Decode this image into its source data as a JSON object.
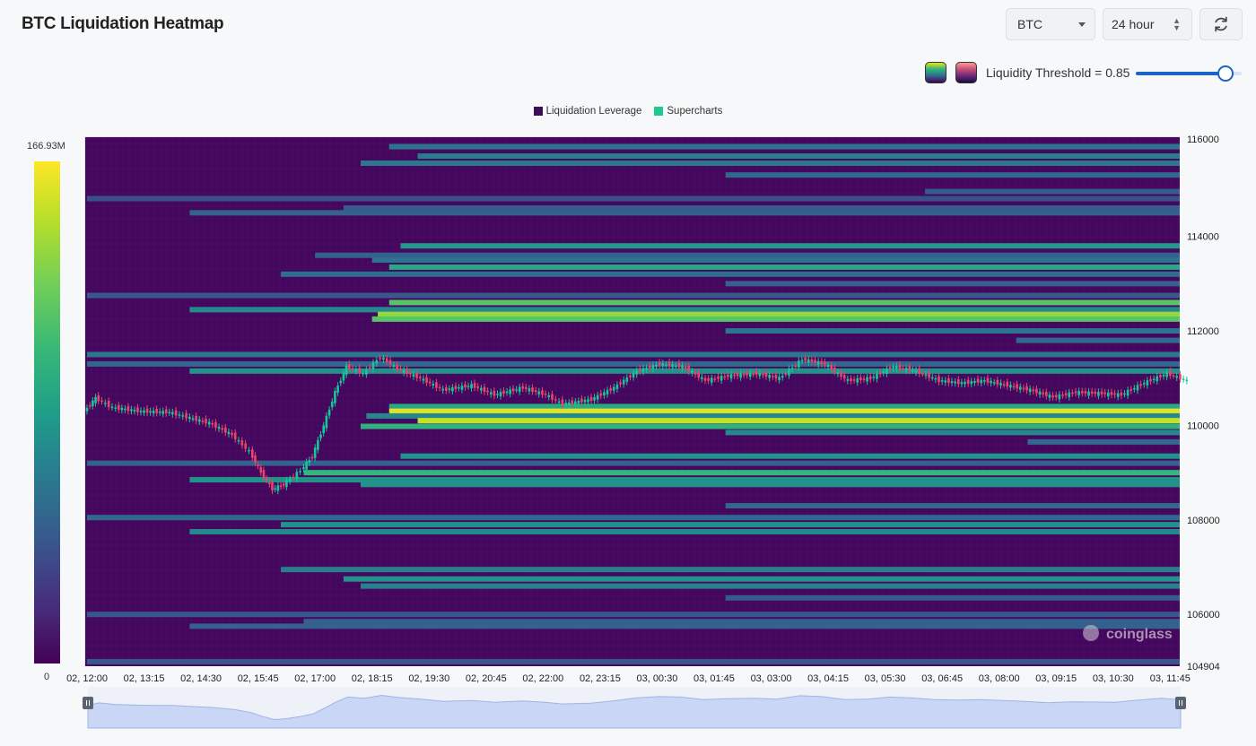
{
  "header": {
    "title": "BTC Liquidation Heatmap",
    "coin_select": "BTC",
    "range_select": "24 hour",
    "refresh_icon": "refresh-icon"
  },
  "threshold": {
    "label": "Liquidity Threshold = 0.85",
    "value": 0.85,
    "palette_1_icon": "viridis-palette-icon",
    "palette_2_icon": "magma-palette-icon"
  },
  "legend": {
    "items": [
      {
        "label": "Liquidation Leverage",
        "color": "#3d0d57"
      },
      {
        "label": "Supercharts",
        "color": "#1dc98e"
      }
    ]
  },
  "colorbar": {
    "max_label": "166.93M",
    "min_label": "0"
  },
  "watermark": "coinglass",
  "chart_data": {
    "type": "heatmap",
    "title": "BTC Liquidation Heatmap",
    "x_ticks": [
      "02, 12:00",
      "02, 13:15",
      "02, 14:30",
      "02, 15:45",
      "02, 17:00",
      "02, 18:15",
      "02, 19:30",
      "02, 20:45",
      "02, 22:00",
      "02, 23:15",
      "03, 00:30",
      "03, 01:45",
      "03, 03:00",
      "03, 04:15",
      "03, 05:30",
      "03, 06:45",
      "03, 08:00",
      "03, 09:15",
      "03, 10:30",
      "03, 11:45"
    ],
    "y_ticks": [
      116000,
      114000,
      112000,
      110000,
      108000,
      106000,
      104904
    ],
    "ylim": [
      104904,
      116100
    ],
    "colorscale": [
      "#440154",
      "#3e4989",
      "#31688e",
      "#26828e",
      "#1f9e89",
      "#35b779",
      "#6ece58",
      "#b5de2b",
      "#fde725"
    ],
    "color_range": [
      0,
      1
    ],
    "bands": [
      {
        "price": 115900,
        "start": 5.3,
        "intensity": 0.3
      },
      {
        "price": 115700,
        "start": 5.8,
        "intensity": 0.35
      },
      {
        "price": 115550,
        "start": 4.8,
        "intensity": 0.32
      },
      {
        "price": 115300,
        "start": 11.2,
        "intensity": 0.25
      },
      {
        "price": 114950,
        "start": 14.7,
        "intensity": 0.2
      },
      {
        "price": 114800,
        "start": 0.0,
        "intensity": 0.15
      },
      {
        "price": 114600,
        "start": 4.5,
        "intensity": 0.2
      },
      {
        "price": 114500,
        "start": 1.8,
        "intensity": 0.22
      },
      {
        "price": 113800,
        "start": 5.5,
        "intensity": 0.48
      },
      {
        "price": 113600,
        "start": 4.0,
        "intensity": 0.22
      },
      {
        "price": 113500,
        "start": 5.0,
        "intensity": 0.3
      },
      {
        "price": 113350,
        "start": 5.3,
        "intensity": 0.55
      },
      {
        "price": 113200,
        "start": 3.4,
        "intensity": 0.28
      },
      {
        "price": 113000,
        "start": 11.2,
        "intensity": 0.22
      },
      {
        "price": 112750,
        "start": 0.0,
        "intensity": 0.18
      },
      {
        "price": 112600,
        "start": 5.3,
        "intensity": 0.7
      },
      {
        "price": 112450,
        "start": 1.8,
        "intensity": 0.4
      },
      {
        "price": 112350,
        "start": 5.1,
        "intensity": 0.82
      },
      {
        "price": 112250,
        "start": 5.0,
        "intensity": 0.7
      },
      {
        "price": 112000,
        "start": 11.2,
        "intensity": 0.3
      },
      {
        "price": 111800,
        "start": 16.3,
        "intensity": 0.25
      },
      {
        "price": 111500,
        "start": 0.0,
        "intensity": 0.32
      },
      {
        "price": 111300,
        "start": 0.0,
        "intensity": 0.25
      },
      {
        "price": 111150,
        "start": 1.8,
        "intensity": 0.45
      },
      {
        "price": 110400,
        "start": 5.3,
        "intensity": 0.55
      },
      {
        "price": 110300,
        "start": 5.3,
        "intensity": 0.95
      },
      {
        "price": 110200,
        "start": 4.9,
        "intensity": 0.4
      },
      {
        "price": 110100,
        "start": 5.8,
        "intensity": 0.9
      },
      {
        "price": 109980,
        "start": 4.8,
        "intensity": 0.6
      },
      {
        "price": 109850,
        "start": 11.2,
        "intensity": 0.4
      },
      {
        "price": 109650,
        "start": 16.5,
        "intensity": 0.25
      },
      {
        "price": 109350,
        "start": 5.5,
        "intensity": 0.45
      },
      {
        "price": 109200,
        "start": 0.0,
        "intensity": 0.22
      },
      {
        "price": 109000,
        "start": 3.8,
        "intensity": 0.62
      },
      {
        "price": 108850,
        "start": 1.8,
        "intensity": 0.45
      },
      {
        "price": 108750,
        "start": 4.8,
        "intensity": 0.45
      },
      {
        "price": 108300,
        "start": 11.2,
        "intensity": 0.25
      },
      {
        "price": 108050,
        "start": 0.0,
        "intensity": 0.25
      },
      {
        "price": 107900,
        "start": 3.4,
        "intensity": 0.45
      },
      {
        "price": 107750,
        "start": 1.8,
        "intensity": 0.4
      },
      {
        "price": 106950,
        "start": 3.4,
        "intensity": 0.35
      },
      {
        "price": 106750,
        "start": 4.5,
        "intensity": 0.45
      },
      {
        "price": 106600,
        "start": 4.8,
        "intensity": 0.38
      },
      {
        "price": 106350,
        "start": 11.2,
        "intensity": 0.2
      },
      {
        "price": 106000,
        "start": 0.0,
        "intensity": 0.18
      },
      {
        "price": 105850,
        "start": 3.8,
        "intensity": 0.22
      },
      {
        "price": 105750,
        "start": 1.8,
        "intensity": 0.22
      },
      {
        "price": 105000,
        "start": 0.0,
        "intensity": 0.18
      }
    ],
    "price_series": [
      {
        "t": 0.0,
        "p": 110300
      },
      {
        "t": 0.2,
        "p": 110580
      },
      {
        "t": 0.5,
        "p": 110380
      },
      {
        "t": 1.0,
        "p": 110300
      },
      {
        "t": 1.5,
        "p": 110280
      },
      {
        "t": 1.8,
        "p": 110180
      },
      {
        "t": 2.2,
        "p": 110050
      },
      {
        "t": 2.6,
        "p": 109800
      },
      {
        "t": 2.9,
        "p": 109450
      },
      {
        "t": 3.1,
        "p": 109000
      },
      {
        "t": 3.3,
        "p": 108650
      },
      {
        "t": 3.5,
        "p": 108750
      },
      {
        "t": 3.8,
        "p": 109050
      },
      {
        "t": 4.0,
        "p": 109350
      },
      {
        "t": 4.2,
        "p": 110000
      },
      {
        "t": 4.4,
        "p": 110700
      },
      {
        "t": 4.6,
        "p": 111250
      },
      {
        "t": 4.9,
        "p": 111100
      },
      {
        "t": 5.2,
        "p": 111450
      },
      {
        "t": 5.5,
        "p": 111200
      },
      {
        "t": 5.9,
        "p": 111000
      },
      {
        "t": 6.3,
        "p": 110750
      },
      {
        "t": 6.8,
        "p": 110850
      },
      {
        "t": 7.2,
        "p": 110650
      },
      {
        "t": 7.7,
        "p": 110800
      },
      {
        "t": 8.1,
        "p": 110650
      },
      {
        "t": 8.4,
        "p": 110450
      },
      {
        "t": 8.9,
        "p": 110550
      },
      {
        "t": 9.3,
        "p": 110800
      },
      {
        "t": 9.7,
        "p": 111150
      },
      {
        "t": 10.1,
        "p": 111300
      },
      {
        "t": 10.5,
        "p": 111250
      },
      {
        "t": 10.9,
        "p": 110950
      },
      {
        "t": 11.3,
        "p": 111050
      },
      {
        "t": 11.8,
        "p": 111100
      },
      {
        "t": 12.2,
        "p": 111000
      },
      {
        "t": 12.6,
        "p": 111400
      },
      {
        "t": 13.0,
        "p": 111300
      },
      {
        "t": 13.4,
        "p": 110950
      },
      {
        "t": 13.8,
        "p": 111000
      },
      {
        "t": 14.2,
        "p": 111250
      },
      {
        "t": 14.6,
        "p": 111150
      },
      {
        "t": 15.0,
        "p": 110950
      },
      {
        "t": 15.4,
        "p": 110900
      },
      {
        "t": 15.8,
        "p": 110950
      },
      {
        "t": 16.2,
        "p": 110850
      },
      {
        "t": 16.6,
        "p": 110750
      },
      {
        "t": 17.0,
        "p": 110600
      },
      {
        "t": 17.4,
        "p": 110700
      },
      {
        "t": 17.8,
        "p": 110680
      },
      {
        "t": 18.2,
        "p": 110650
      },
      {
        "t": 18.6,
        "p": 110900
      },
      {
        "t": 19.0,
        "p": 111100
      },
      {
        "t": 19.35,
        "p": 110950
      }
    ]
  }
}
